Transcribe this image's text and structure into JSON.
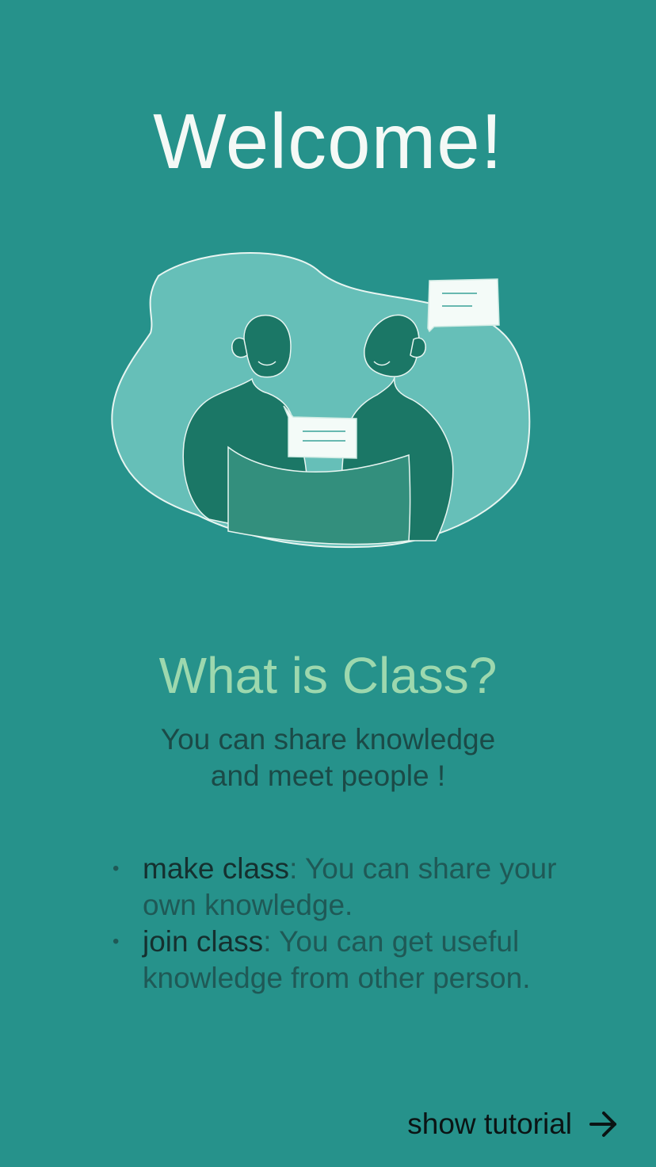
{
  "welcome": {
    "title": "Welcome!"
  },
  "illustration": {
    "icon": "people-chat-illustration",
    "colors": {
      "blob": "#66bfb8",
      "person": "#1b7766",
      "table": "#338f7d",
      "bubble": "#f4fbf8"
    }
  },
  "intro": {
    "subtitle": "What is Class?",
    "tagline_line1": "You can share knowledge",
    "tagline_line2": "and meet people !"
  },
  "features": [
    {
      "term": "make class",
      "description": ": You can share your own knowledge."
    },
    {
      "term": "join class",
      "description": ": You can get useful knowledge from other person."
    }
  ],
  "tutorial": {
    "label": "show tutorial",
    "icon": "arrow-right-icon"
  },
  "colors": {
    "background": "#26928b",
    "title": "#f4f9f6",
    "subtitle": "#9dd8ae",
    "body_text": "#1b4a47"
  }
}
